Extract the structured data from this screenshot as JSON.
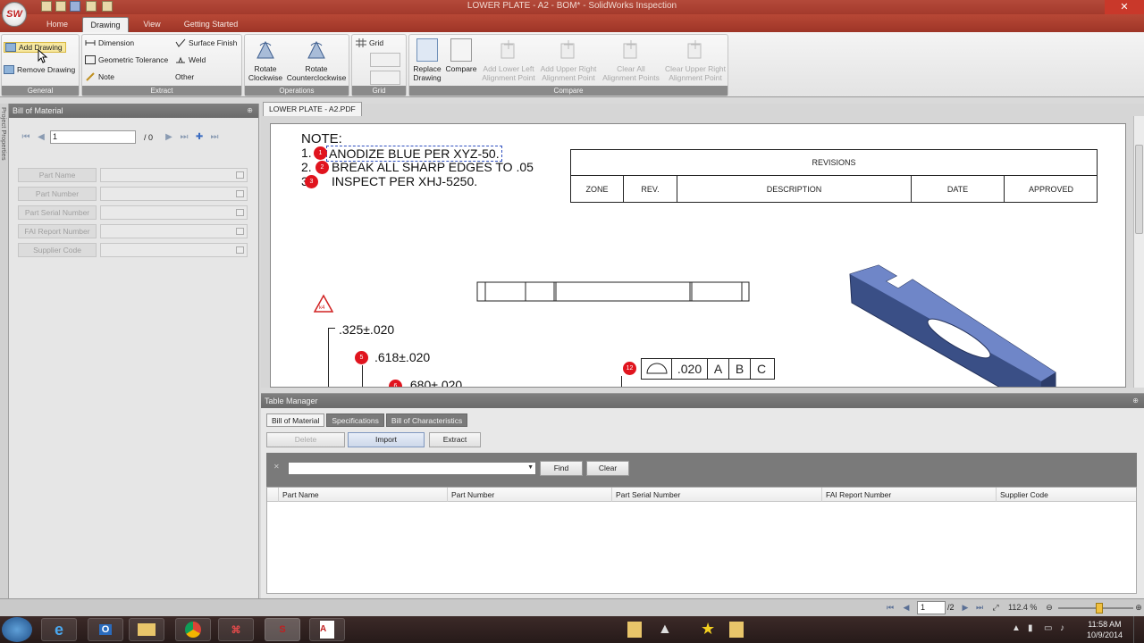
{
  "window": {
    "title": "LOWER PLATE - A2 - BOM* - SolidWorks Inspection",
    "logo_text": "SW",
    "close_label": "✕"
  },
  "ribbon_tabs": [
    "Home",
    "Drawing",
    "View",
    "Getting Started"
  ],
  "ribbon": {
    "general": {
      "label": "General",
      "add_drawing": "Add Drawing",
      "remove_drawing": "Remove Drawing"
    },
    "extract": {
      "label": "Extract",
      "dimension": "Dimension",
      "geometric_tolerance": "Geometric Tolerance",
      "note": "Note",
      "surface_finish": "Surface Finish",
      "weld": "Weld",
      "other": "Other"
    },
    "operations": {
      "label": "Operations",
      "rotate_cw": [
        "Rotate",
        "Clockwise"
      ],
      "rotate_ccw": [
        "Rotate",
        "Counterclockwise"
      ]
    },
    "grid": {
      "label": "Grid",
      "grid": "Grid"
    },
    "compare": {
      "label": "Compare",
      "replace_drawing": [
        "Replace",
        "Drawing"
      ],
      "compare": "Compare",
      "add_lower_left": [
        "Add Lower Left",
        "Alignment Point"
      ],
      "add_upper_right": [
        "Add Upper Right",
        "Alignment Point"
      ],
      "clear_all": [
        "Clear All",
        "Alignment Points"
      ],
      "clear_upper_right": [
        "Clear Upper Right",
        "Alignment Point"
      ]
    }
  },
  "side_strip_label": "Project Properties",
  "bom_panel": {
    "title": "Bill of Material",
    "page_value": "1",
    "page_total": "/ 0",
    "fields": [
      "Part Name",
      "Part Number",
      "Part Serial Number",
      "FAI Report Number",
      "Supplier Code"
    ]
  },
  "document": {
    "tab": "LOWER PLATE - A2.PDF",
    "notes": {
      "heading": "NOTE:",
      "lines": [
        {
          "num": "1.",
          "text": "ANODIZE BLUE PER XYZ-50.",
          "balloon": "1"
        },
        {
          "num": "2.",
          "text": "BREAK ALL SHARP EDGES TO .05",
          "balloon": "2"
        },
        {
          "num": "3.",
          "text": "INSPECT PER XHJ-5250.",
          "balloon": "3"
        }
      ]
    },
    "revisions": {
      "title": "REVISIONS",
      "columns": [
        "ZONE",
        "REV.",
        "DESCRIPTION",
        "DATE",
        "APPROVED"
      ]
    },
    "dims": {
      "d1": ".325±.020",
      "d2": ".618±.020",
      "d3": ".680±.020",
      "balloon_d2": "5",
      "balloon_d3": "6",
      "triangle": "k4"
    },
    "gdt": {
      "balloon": "12",
      "tolerance": ".020",
      "datums": [
        "A",
        "B",
        "C"
      ]
    }
  },
  "table_manager": {
    "title": "Table Manager",
    "tabs": [
      "Bill of Material",
      "Specifications",
      "Bill of Characteristics"
    ],
    "buttons": {
      "delete": "Delete",
      "import": "Import",
      "extract": "Extract"
    },
    "filter": {
      "find": "Find",
      "clear": "Clear",
      "clear_icon": "✕"
    },
    "columns": [
      "Part Name",
      "Part Number",
      "Part Serial Number",
      "FAI Report Number",
      "Supplier Code"
    ]
  },
  "statusbar": {
    "page_value": "1",
    "page_total": "/2",
    "zoom": "112.4 %",
    "zoom_level": 0.55
  },
  "taskbar": {
    "time": "11:58 AM",
    "date": "10/9/2014"
  }
}
